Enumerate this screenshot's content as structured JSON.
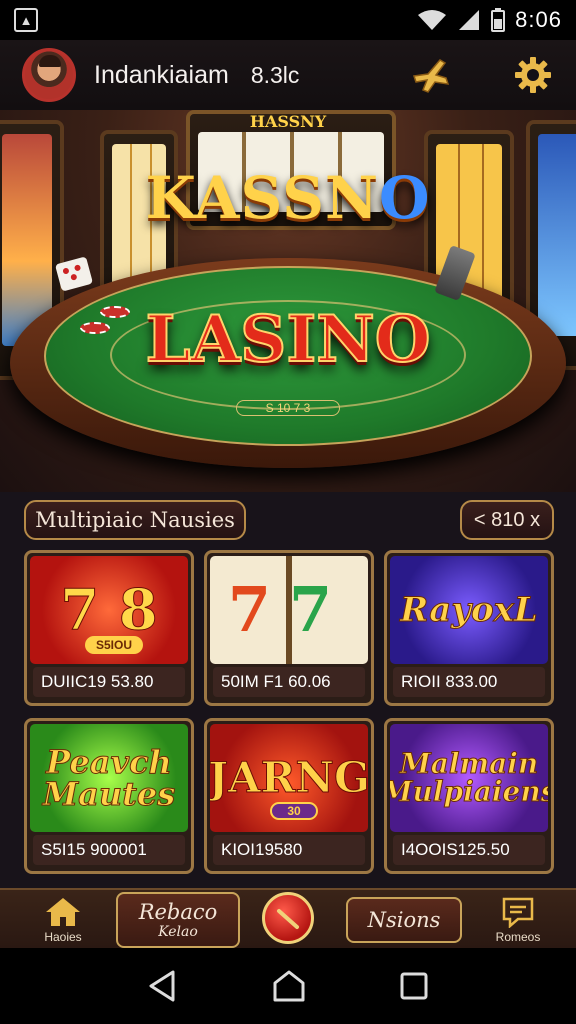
{
  "status": {
    "time": "8:06"
  },
  "header": {
    "username": "Indankiaiam",
    "balance": "8.3lc"
  },
  "hero": {
    "top_small": "HASSNY",
    "top_logo_main": "KASSN",
    "top_logo_o": "O",
    "center_logo": "LASINO",
    "center_sub": "S 10 7 3"
  },
  "section": {
    "title": "Multipiaic Nausies",
    "badge": "< 810 x",
    "games": [
      {
        "art_text": "7 8",
        "mini": "S5IOU",
        "footer": "DUIIC19 53.80"
      },
      {
        "art_text_a": "7",
        "art_text_b": "7",
        "footer": "50IM F1 60.06"
      },
      {
        "art_text": "RayoxL",
        "footer": "RIOII 833.00"
      },
      {
        "art_text": "Peavch Mautes",
        "footer": "S5I15 900001"
      },
      {
        "art_text": "JARNG",
        "mini": "30",
        "footer": "KIOI19580"
      },
      {
        "art_text": "Malmain Mulpiaiens",
        "footer": "I4OOIS125.50"
      }
    ]
  },
  "bottom_nav": {
    "home": "Haoies",
    "reward_l1": "Rebaco",
    "reward_l2": "Kelao",
    "news": "Nsions",
    "rewards": "Romeos"
  },
  "colors": {
    "accent_gold": "#c9a45a",
    "accent_red": "#e32b1a",
    "felt": "#1f7a2a"
  },
  "icons": {
    "status": [
      "app-notice-icon",
      "wifi-icon",
      "signal-icon",
      "battery-icon"
    ],
    "header": [
      "plane-icon",
      "gear-icon"
    ],
    "nav": [
      "home-icon",
      "chat-icon"
    ],
    "system": [
      "back-icon",
      "home-circle-icon",
      "recents-icon"
    ]
  }
}
